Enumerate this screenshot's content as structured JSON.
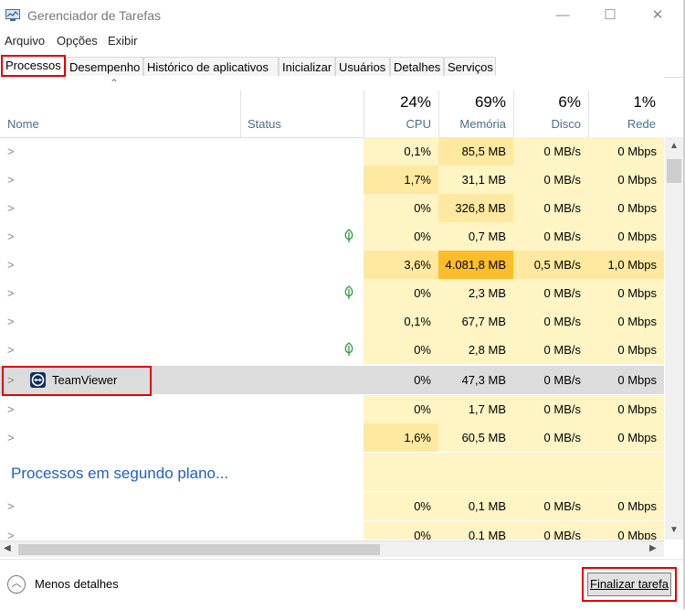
{
  "window": {
    "title": "Gerenciador de Tarefas",
    "minimize": "—",
    "maximize": "☐",
    "close": "✕"
  },
  "menu": [
    "Arquivo",
    "Opções",
    "Exibir"
  ],
  "tabs": [
    "Processos",
    "Desempenho",
    "Histórico de aplicativos",
    "Inicializar",
    "Usuários",
    "Detalhes",
    "Serviços"
  ],
  "active_tab": "Processos",
  "columns": {
    "name": "Nome",
    "status": "Status",
    "cpu": {
      "label": "CPU",
      "pct": "24%"
    },
    "mem": {
      "label": "Memória",
      "pct": "69%"
    },
    "disk": {
      "label": "Disco",
      "pct": "6%"
    },
    "net": {
      "label": "Rede",
      "pct": "1%"
    }
  },
  "rows": [
    {
      "name": "",
      "eco": false,
      "cpu": "0,1%",
      "mem": "85,5 MB",
      "disk": "0 MB/s",
      "net": "0 Mbps"
    },
    {
      "name": "",
      "eco": false,
      "cpu": "1,7%",
      "mem": "31,1 MB",
      "disk": "0 MB/s",
      "net": "0 Mbps"
    },
    {
      "name": "",
      "eco": false,
      "cpu": "0%",
      "mem": "326,8 MB",
      "disk": "0 MB/s",
      "net": "0 Mbps"
    },
    {
      "name": "",
      "eco": true,
      "cpu": "0%",
      "mem": "0,7 MB",
      "disk": "0 MB/s",
      "net": "0 Mbps"
    },
    {
      "name": "",
      "eco": false,
      "cpu": "3,6%",
      "mem": "4.081,8 MB",
      "disk": "0,5 MB/s",
      "net": "1,0 Mbps"
    },
    {
      "name": "",
      "eco": true,
      "cpu": "0%",
      "mem": "2,3 MB",
      "disk": "0 MB/s",
      "net": "0 Mbps"
    },
    {
      "name": "",
      "eco": false,
      "cpu": "0,1%",
      "mem": "67,7 MB",
      "disk": "0 MB/s",
      "net": "0 Mbps"
    },
    {
      "name": "",
      "eco": true,
      "cpu": "0%",
      "mem": "2,8 MB",
      "disk": "0 MB/s",
      "net": "0 Mbps"
    },
    {
      "name": "TeamViewer",
      "eco": false,
      "cpu": "0%",
      "mem": "47,3 MB",
      "disk": "0 MB/s",
      "net": "0 Mbps",
      "selected": true
    },
    {
      "name": "",
      "eco": false,
      "cpu": "0%",
      "mem": "1,7 MB",
      "disk": "0 MB/s",
      "net": "0 Mbps"
    },
    {
      "name": "",
      "eco": false,
      "cpu": "1,6%",
      "mem": "60,5 MB",
      "disk": "0 MB/s",
      "net": "0 Mbps"
    }
  ],
  "background_section": "Processos em segundo plano...",
  "background_rows": [
    {
      "name": "",
      "cpu": "0%",
      "mem": "0,1 MB",
      "disk": "0 MB/s",
      "net": "0 Mbps"
    },
    {
      "name": "",
      "cpu": "0%",
      "mem": "0,1 MB",
      "disk": "0 MB/s",
      "net": "0 Mbps"
    }
  ],
  "footer": {
    "less_details": "Menos detalhes",
    "end_task": "Finalizar tarefa"
  },
  "colors": {
    "highlight_border": "#e00000",
    "hot_cell": "#fbbd2a",
    "link_blue": "#1f5fbf"
  },
  "icons": {
    "app": "task-manager-icon",
    "eco": "leaf-icon",
    "teamviewer": "teamviewer-icon",
    "collapse": "chevron-up-icon"
  }
}
